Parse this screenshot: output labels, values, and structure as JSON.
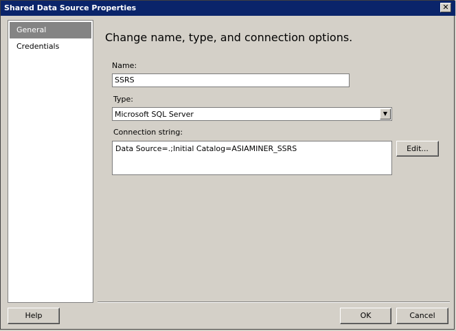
{
  "window": {
    "title": "Shared Data Source Properties",
    "close_glyph": "✕"
  },
  "nav": {
    "items": [
      {
        "label": "General",
        "selected": true
      },
      {
        "label": "Credentials",
        "selected": false
      }
    ]
  },
  "form": {
    "heading": "Change name, type, and connection options.",
    "name_label": "Name:",
    "name_value": "SSRS",
    "type_label": "Type:",
    "type_value": "Microsoft SQL Server",
    "connection_label": "Connection string:",
    "connection_value": "Data Source=.;Initial Catalog=ASIAMINER_SSRS",
    "edit_button": "Edit..."
  },
  "footer": {
    "help_button": "Help",
    "ok_button": "OK",
    "cancel_button": "Cancel"
  }
}
